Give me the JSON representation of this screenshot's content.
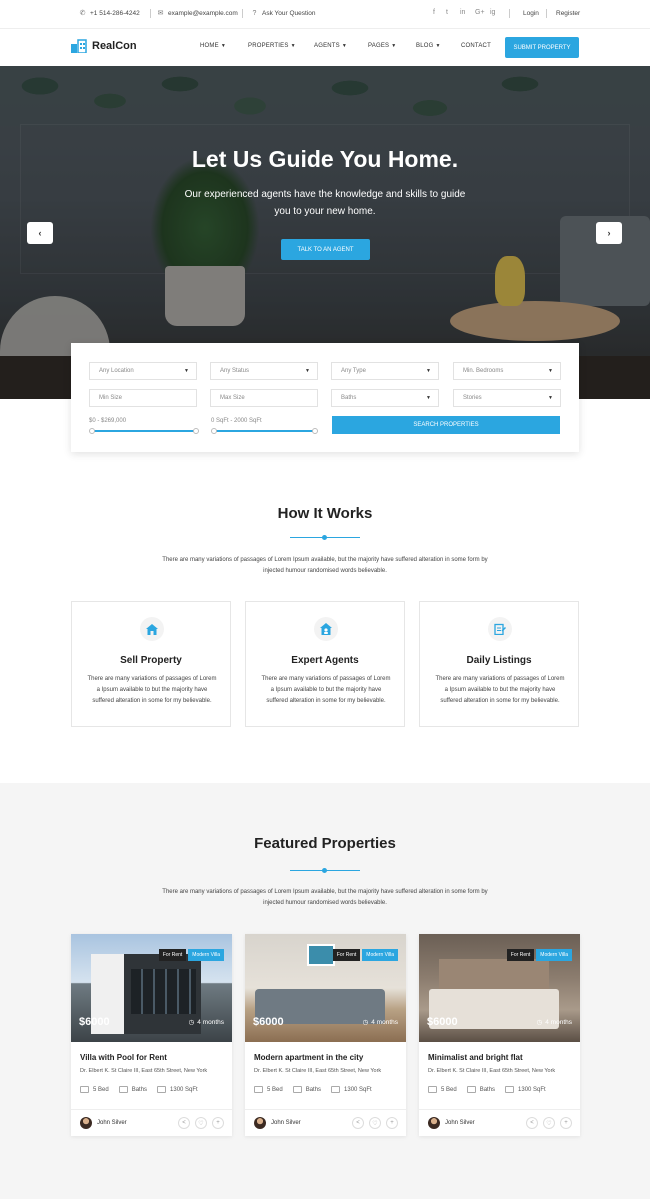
{
  "topbar": {
    "phone": "+1 514-286-4242",
    "email": "example@example.com",
    "question": "Ask Your Question",
    "social": [
      "f",
      "t",
      "in",
      "G+",
      "ig"
    ],
    "login": "Login",
    "register": "Register"
  },
  "nav": {
    "logo": "RealCon",
    "items": [
      "HOME",
      "PROPERTIES",
      "AGENTS",
      "PAGES",
      "BLOG",
      "CONTACT"
    ],
    "submit": "SUBMIT PROPERTY"
  },
  "hero": {
    "title": "Let Us Guide You Home.",
    "subtitle": "Our experienced agents have the knowledge and skills to guide you to your new home.",
    "cta": "TALK TO AN AGENT",
    "prev": "‹",
    "next": "›"
  },
  "search": {
    "location": "Any Location",
    "status": "Any Status",
    "type": "Any Type",
    "bedrooms": "Min. Bedrooms",
    "min_size": "Min Size",
    "max_size": "Max Size",
    "baths": "Baths",
    "stories": "Stories",
    "price_range": "$0 - $269,000",
    "sqft_range": "0 SqFt - 2000 SqFt",
    "button": "SEARCH PROPERTIES"
  },
  "how": {
    "title": "How It Works",
    "desc": "There are many variations of passages of Lorem Ipsum available, but the majority have suffered alteration in some form by injected humour randomised words believable.",
    "cards": [
      {
        "title": "Sell Property",
        "text": "There are many variations of passages of Lorem a Ipsum available to but the majority have suffered alteration in some for my believable."
      },
      {
        "title": "Expert Agents",
        "text": "There are many variations of passages of Lorem a Ipsum available to but the majority have suffered alteration in some for my believable."
      },
      {
        "title": "Daily Listings",
        "text": "There are many variations of passages of Lorem a Ipsum available to but the majority have suffered alteration in some for my believable."
      }
    ]
  },
  "featured": {
    "title": "Featured Properties",
    "desc": "There are many variations of passages of Lorem Ipsum available, but the majority have suffered alteration in some form by injected humour randomised words believable.",
    "props": [
      {
        "badge1": "For Rent",
        "badge2": "Modern Villa",
        "price": "$6000",
        "duration": "4 months",
        "title": "Villa with Pool for Rent",
        "address": "Dr. Elbert K. St Claire III, East 65th Street, New York",
        "beds": "5 Bed",
        "baths": "Baths",
        "sqft": "1300 SqFt",
        "agent": "John Silver"
      },
      {
        "badge1": "For Rent",
        "badge2": "Modern Villa",
        "price": "$6000",
        "duration": "4 months",
        "title": "Modern apartment in the city",
        "address": "Dr. Elbert K. St Claire III, East 65th Street, New York",
        "beds": "5 Bed",
        "baths": "Baths",
        "sqft": "1300 SqFt",
        "agent": "John Silver"
      },
      {
        "badge1": "For Rent",
        "badge2": "Modern Villa",
        "price": "$6000",
        "duration": "4 months",
        "title": "Minimalist and bright flat",
        "address": "Dr. Elbert K. St Claire III, East 65th Street, New York",
        "beds": "5 Bed",
        "baths": "Baths",
        "sqft": "1300 SqFt",
        "agent": "John Silver"
      }
    ]
  },
  "colors": {
    "accent": "#2ba6e0"
  }
}
